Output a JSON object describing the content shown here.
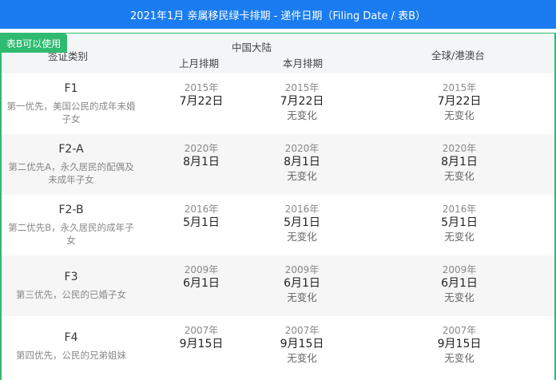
{
  "title": "2021年1月 亲属移民绿卡排期 - 递件日期（Filing Date / 表B）",
  "badge": "表B可以使用",
  "header": {
    "category": "签证类别",
    "mainland": "中国大陆",
    "last_month": "上月排期",
    "this_month": "本月排期",
    "global": "全球/港澳台"
  },
  "rows": [
    {
      "code": "F1",
      "desc": "第一优先，美国公民的成年未婚子女",
      "last": {
        "year": "2015年",
        "md": "7月22日"
      },
      "this": {
        "year": "2015年",
        "md": "7月22日",
        "change": "无变化"
      },
      "global": {
        "year": "2015年",
        "md": "7月22日",
        "change": "无变化"
      }
    },
    {
      "code": "F2-A",
      "desc": "第二优先A，永久居民的配偶及未成年子女",
      "last": {
        "year": "2020年",
        "md": "8月1日"
      },
      "this": {
        "year": "2020年",
        "md": "8月1日",
        "change": "无变化"
      },
      "global": {
        "year": "2020年",
        "md": "8月1日",
        "change": "无变化"
      }
    },
    {
      "code": "F2-B",
      "desc": "第二优先B，永久居民的成年子女",
      "last": {
        "year": "2016年",
        "md": "5月1日"
      },
      "this": {
        "year": "2016年",
        "md": "5月1日",
        "change": "无变化"
      },
      "global": {
        "year": "2016年",
        "md": "5月1日",
        "change": "无变化"
      }
    },
    {
      "code": "F3",
      "desc": "第三优先，公民的已婚子女",
      "last": {
        "year": "2009年",
        "md": "6月1日"
      },
      "this": {
        "year": "2009年",
        "md": "6月1日",
        "change": "无变化"
      },
      "global": {
        "year": "2009年",
        "md": "6月1日",
        "change": "无变化"
      }
    },
    {
      "code": "F4",
      "desc": "第四优先，公民的兄弟姐妹",
      "last": {
        "year": "2007年",
        "md": "9月15日"
      },
      "this": {
        "year": "2007年",
        "md": "9月15日",
        "change": "无变化"
      },
      "global": {
        "year": "2007年",
        "md": "9月15日",
        "change": "无变化"
      }
    }
  ]
}
